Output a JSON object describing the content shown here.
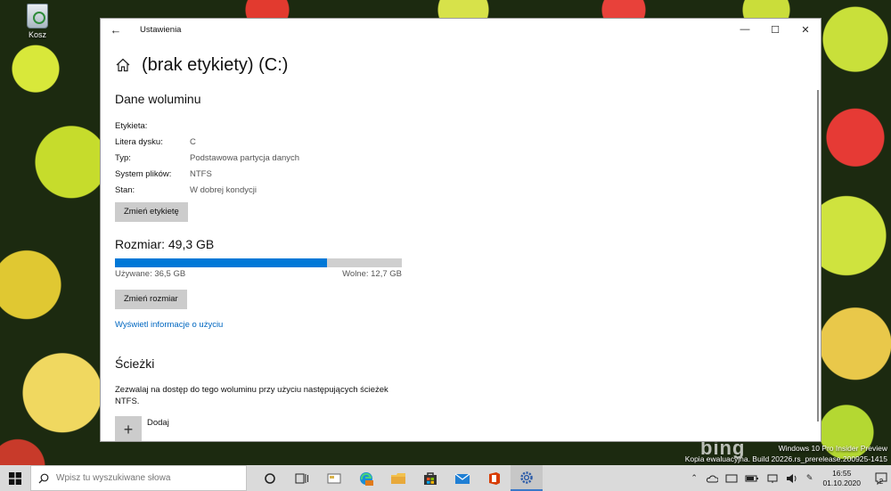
{
  "desktop": {
    "recycle_bin_label": "Kosz"
  },
  "window": {
    "app_title": "Ustawienia",
    "back_glyph": "←",
    "minimize_glyph": "—",
    "maximize_glyph": "☐",
    "close_glyph": "✕",
    "page_title": "(brak etykiety) (C:)"
  },
  "volume": {
    "section_title": "Dane woluminu",
    "properties": [
      {
        "key": "Etykieta:",
        "value": ""
      },
      {
        "key": "Litera dysku:",
        "value": "C"
      },
      {
        "key": "Typ:",
        "value": "Podstawowa partycja danych"
      },
      {
        "key": "System plików:",
        "value": "NTFS"
      },
      {
        "key": "Stan:",
        "value": "W dobrej kondycji"
      }
    ],
    "change_label_button": "Zmień etykietę"
  },
  "size": {
    "title": "Rozmiar: 49,3 GB",
    "used_label": "Używane: 36,5 GB",
    "free_label": "Wolne: 12,7 GB",
    "used_fraction": 0.74,
    "accent_color": "#0078d7",
    "resize_button": "Zmień rozmiar",
    "usage_link": "Wyświetl informacje o użyciu"
  },
  "paths": {
    "title": "Ścieżki",
    "description": "Zezwalaj na dostęp do tego woluminu przy użyciu następujących ścieżek NTFS.",
    "add_label": "Dodaj"
  },
  "watermark": {
    "bing": "bing",
    "line1": "Windows 10 Pro Insider Preview",
    "line2": "Kopia ewaluacyjna. Build 20226.rs_prerelease.200925-1415"
  },
  "taskbar": {
    "search_placeholder": "Wpisz tu wyszukiwane słowa",
    "time": "16:55",
    "date": "01.10.2020",
    "notification_count": "2",
    "icons": [
      "windows-start-icon",
      "search-icon",
      "task-view-icon",
      "widgets-icon",
      "edge-icon",
      "file-explorer-icon",
      "store-icon",
      "mail-icon",
      "office-icon",
      "settings-icon"
    ]
  }
}
